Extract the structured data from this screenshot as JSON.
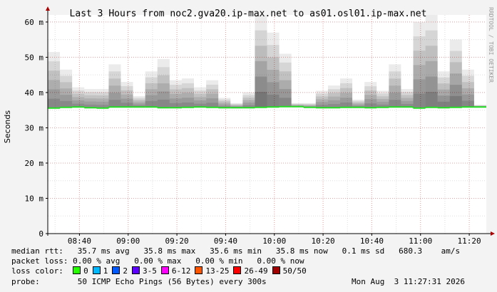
{
  "chart_data": {
    "type": "area",
    "title": "Last 3 Hours from noc2.gva20.ip-max.net to as01.osl01.ip-max.net",
    "ylabel": "Seconds",
    "watermark": "RRDTOOL / TOBI OETIKER",
    "ylim": [
      0,
      62
    ],
    "y_tick_values": [
      0,
      10,
      20,
      30,
      40,
      50,
      60
    ],
    "y_tick_labels": [
      "0",
      "10 m",
      "20 m",
      "30 m",
      "40 m",
      "50 m",
      "60 m"
    ],
    "x_tick_labels": [
      "08:40",
      "09:00",
      "09:20",
      "09:40",
      "10:00",
      "10:20",
      "10:40",
      "11:00",
      "11:20"
    ],
    "x_tick_minutes": [
      40,
      60,
      80,
      100,
      120,
      140,
      160,
      180,
      200
    ],
    "x_range_minutes": [
      27,
      207
    ],
    "grid": true,
    "colors": {
      "median": "#22dd22",
      "smoke": "#000000",
      "grid_major": "#e6a0a0",
      "grid_minor": "#dddddd",
      "axis": "#000000",
      "arrow": "#aa0000",
      "canvas": "#ffffff",
      "frame": "#f3f3f3"
    },
    "series": [
      {
        "name": "median rtt",
        "interval_minutes": 5,
        "start_minute": 27,
        "median": [
          35.6,
          35.8,
          35.9,
          35.7,
          35.6,
          35.9,
          35.9,
          35.9,
          35.9,
          35.7,
          35.7,
          35.8,
          35.9,
          35.8,
          35.7,
          35.7,
          35.7,
          35.8,
          35.9,
          36.0,
          36.0,
          35.8,
          35.7,
          35.7,
          35.8,
          35.8,
          35.7,
          35.8,
          35.9,
          35.9,
          35.6,
          35.8,
          35.7,
          35.8,
          35.9,
          35.9
        ],
        "max": [
          51.5,
          46.5,
          41.5,
          41.0,
          41.0,
          48.0,
          43.0,
          39.0,
          46.0,
          49.5,
          43.5,
          44.0,
          41.5,
          43.5,
          38.5,
          37.0,
          40.0,
          62.0,
          57.0,
          51.0,
          37.0,
          37.0,
          40.5,
          42.0,
          44.0,
          38.0,
          43.0,
          40.5,
          48.0,
          41.0,
          60.0,
          62.0,
          46.0,
          55.0,
          46.5,
          36.5
        ],
        "spread": [
          0.45,
          0.4,
          0.35,
          0.3,
          0.3,
          0.45,
          0.4,
          0.3,
          0.4,
          0.45,
          0.4,
          0.4,
          0.35,
          0.4,
          0.3,
          0.3,
          0.35,
          0.9,
          0.6,
          0.5,
          0.2,
          0.2,
          0.35,
          0.35,
          0.4,
          0.3,
          0.4,
          0.35,
          0.45,
          0.35,
          0.5,
          0.7,
          0.7,
          0.8,
          0.5,
          0.2
        ]
      }
    ]
  },
  "legend": {
    "median_rtt": {
      "label": "median rtt:",
      "values": "35.7 ms avg   35.8 ms max   35.6 ms min   35.8 ms now   0.1 ms sd   680.3    am/s"
    },
    "packet_loss": {
      "label": "packet loss:",
      "values": "0.00 % avg   0.00 % max   0.00 % min   0.00 % now"
    },
    "loss_color": {
      "label": "loss color:",
      "items": [
        {
          "label": "0",
          "color": "#26ff00"
        },
        {
          "label": "1",
          "color": "#00b8ff"
        },
        {
          "label": "2",
          "color": "#0059ff"
        },
        {
          "label": "3-5",
          "color": "#5e00ff"
        },
        {
          "label": "6-12",
          "color": "#ff00ff"
        },
        {
          "label": "13-25",
          "color": "#ff5500"
        },
        {
          "label": "26-49",
          "color": "#ff0000"
        },
        {
          "label": "50/50",
          "color": "#a10000"
        }
      ]
    },
    "probe": {
      "label": "probe:",
      "value": "50 ICMP Echo Pings (56 Bytes) every 300s"
    },
    "date": "Mon Aug  3 11:27:31 2026"
  }
}
